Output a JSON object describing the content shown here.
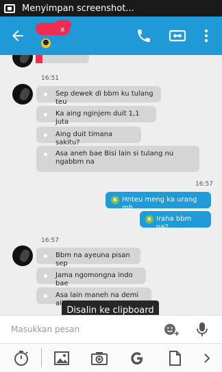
{
  "status_bar": {
    "text": "Menyimpan screenshot..."
  },
  "header": {
    "contact_name": "x"
  },
  "chat": {
    "group1": {
      "time": "16:51",
      "messages": [
        "Sep dewek di bbm ku tulang teu",
        "Ka aing nginjem duit 1,1 juta",
        "Aing duit timana sakitu?",
        "Asa aneh bae Bisi lain si tulang nu ngabbm na"
      ]
    },
    "outgoing": {
      "time": "16:57",
      "messages": [
        "Hnteu meng ka urang mh",
        "Iraha bbm na?"
      ],
      "avatar_letter": "R"
    },
    "group2": {
      "time": "16:57",
      "messages": [
        "Bbm na ayeuna pisan sep",
        "Jama ngomongna indo bae",
        "Asa lain maneh na demi allah"
      ]
    }
  },
  "toast": {
    "text": "Disalin ke clipboard"
  },
  "composer": {
    "placeholder": "Masukkan pesan"
  },
  "colors": {
    "appbar": "#1f9ad6",
    "outgoing_bubble": "#1e9bd8",
    "incoming_bubble": "#d5d5d5"
  }
}
